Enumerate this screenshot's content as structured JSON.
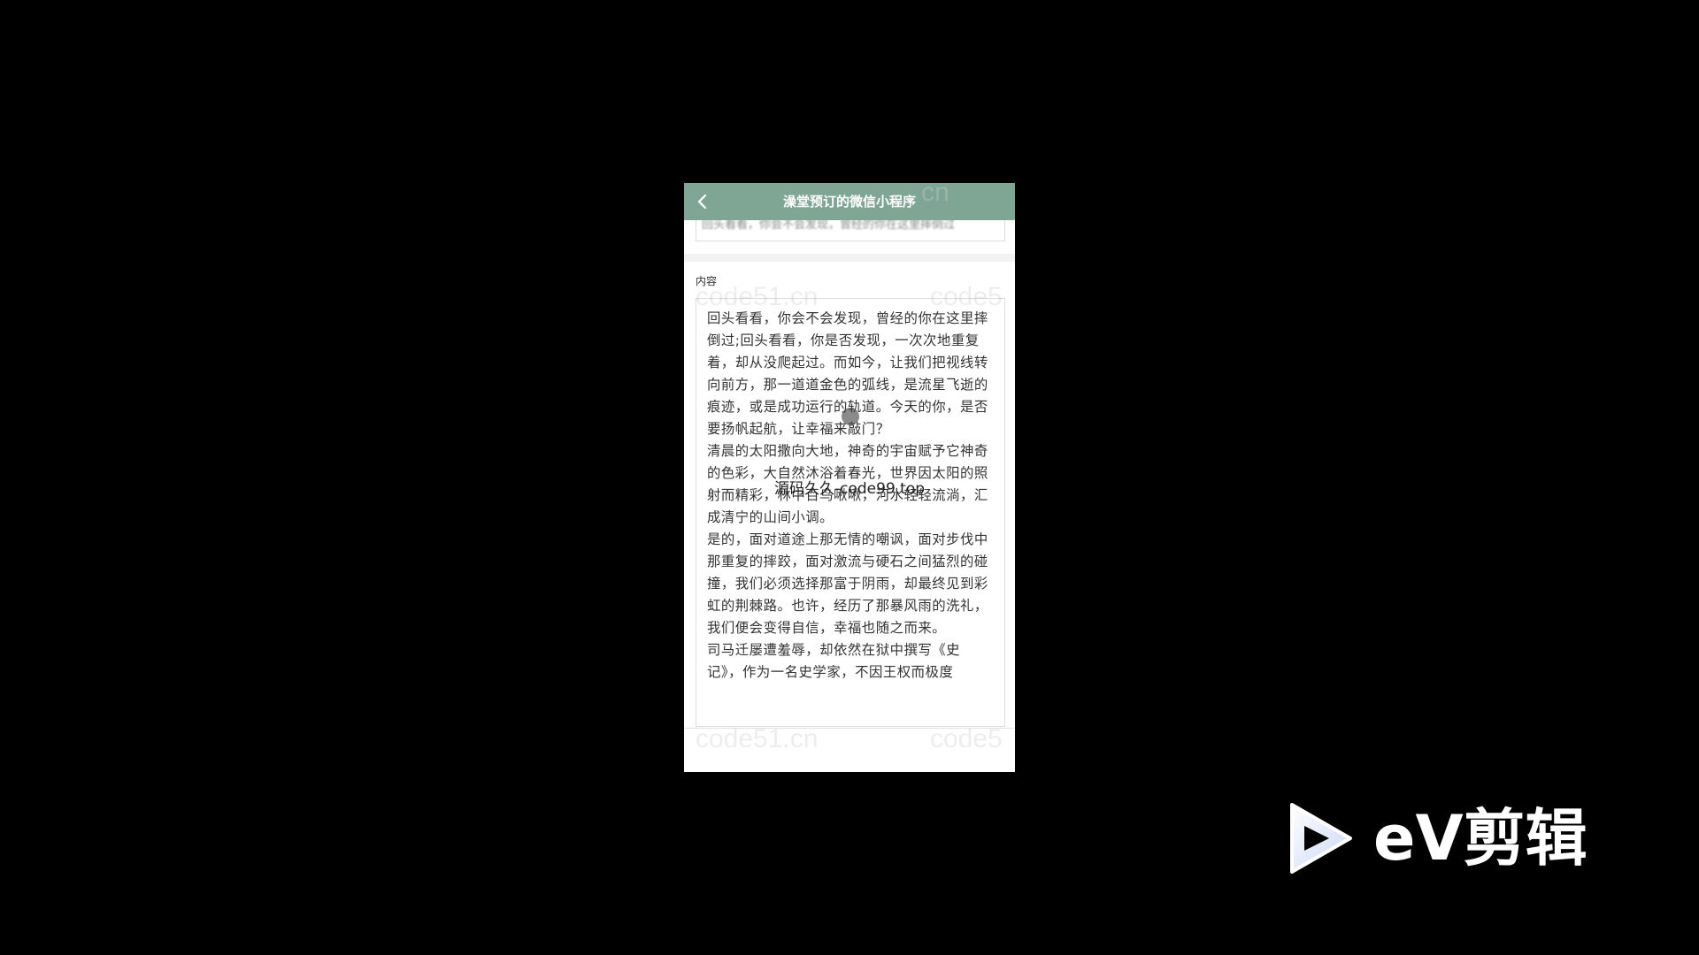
{
  "navbar": {
    "title": "澡堂预订的微信小程序",
    "back_icon": "chevron-left-icon",
    "color": "#7fa595"
  },
  "prev_field": {
    "value": "回头看看，你会不会发现，曾经的你在这里摔倒过"
  },
  "content": {
    "label": "内容",
    "paragraphs": [
      "回头看看，你会不会发现，曾经的你在这里摔倒过;回头看看，你是否发现，一次次地重复着，却从没爬起过。而如今，让我们把视线转向前方，那一道道金色的弧线，是流星飞逝的痕迹，或是成功运行的轨道。今天的你，是否要扬帆起航，让幸福来敲门？",
      "清晨的太阳撒向大地，神奇的宇宙赋予它神奇的色彩，大自然沐浴着春光，世界因太阳的照射而精彩，林中百鸟啾啾，河水轻轻流淌，汇成清宁的山间小调。",
      "是的，面对道途上那无情的嘲讽，面对步伐中那重复的摔跤，面对激流与硬石之间猛烈的碰撞，我们必须选择那富于阴雨，却最终见到彩虹的荆棘路。也许，经历了那暴风雨的洗礼，我们便会变得自信，幸福也随之而来。",
      "司马迁屡遭羞辱，却依然在狱中撰写《史记》，作为一名史学家，不因王权而极度"
    ]
  },
  "watermarks": {
    "site": "code51.cn",
    "site_partial": "code5",
    "nav_partial": "cn",
    "center": "源码久久-code99.top"
  },
  "logo": {
    "text": "eV剪辑",
    "icon": "play-icon"
  }
}
